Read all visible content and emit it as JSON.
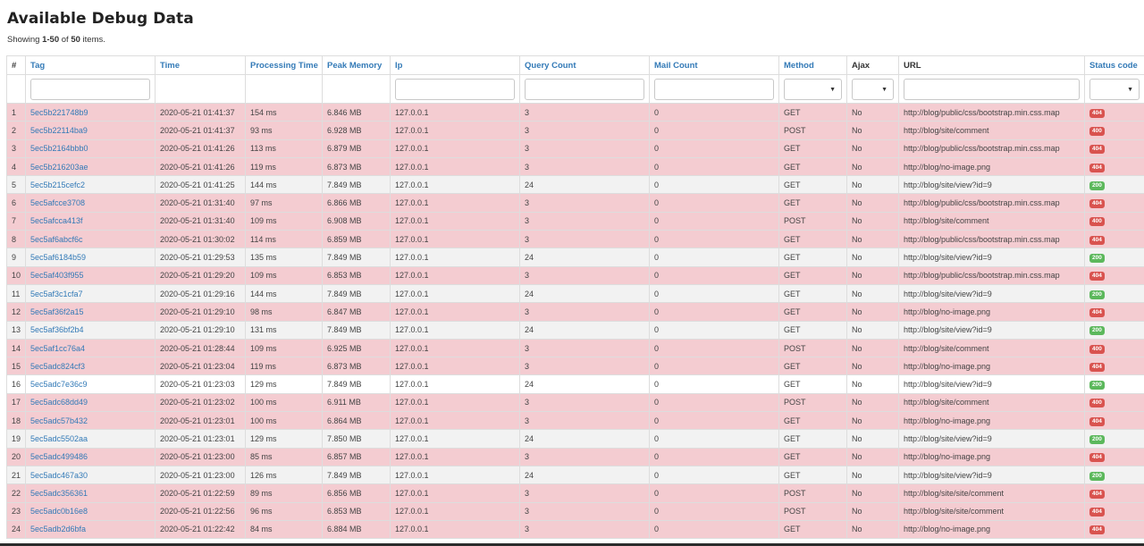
{
  "page": {
    "title": "Available Debug Data",
    "summary_prefix": "Showing ",
    "summary_range": "1-50",
    "summary_mid": " of ",
    "summary_total": "50",
    "summary_suffix": " items."
  },
  "columns": {
    "num": "#",
    "tag": "Tag",
    "time": "Time",
    "processing_time": "Processing Time",
    "peak_memory": "Peak Memory",
    "ip": "Ip",
    "query_count": "Query Count",
    "mail_count": "Mail Count",
    "method": "Method",
    "ajax": "Ajax",
    "url": "URL",
    "status_code": "Status code"
  },
  "colors": {
    "link": "#337ab7",
    "error_row": "#f4ccd1",
    "badge_error": "#d9534f",
    "badge_success": "#5cb85c"
  },
  "rows": [
    {
      "num": "1",
      "tag": "5ec5b221748b9",
      "time": "2020-05-21 01:41:37",
      "proc": "154 ms",
      "mem": "6.846 MB",
      "ip": "127.0.0.1",
      "queries": "3",
      "mails": "0",
      "method": "GET",
      "ajax": "No",
      "url": "http://blog/public/css/bootstrap.min.css.map",
      "status": "404"
    },
    {
      "num": "2",
      "tag": "5ec5b22114ba9",
      "time": "2020-05-21 01:41:37",
      "proc": "93 ms",
      "mem": "6.928 MB",
      "ip": "127.0.0.1",
      "queries": "3",
      "mails": "0",
      "method": "POST",
      "ajax": "No",
      "url": "http://blog/site/comment",
      "status": "400"
    },
    {
      "num": "3",
      "tag": "5ec5b2164bbb0",
      "time": "2020-05-21 01:41:26",
      "proc": "113 ms",
      "mem": "6.879 MB",
      "ip": "127.0.0.1",
      "queries": "3",
      "mails": "0",
      "method": "GET",
      "ajax": "No",
      "url": "http://blog/public/css/bootstrap.min.css.map",
      "status": "404"
    },
    {
      "num": "4",
      "tag": "5ec5b216203ae",
      "time": "2020-05-21 01:41:26",
      "proc": "119 ms",
      "mem": "6.873 MB",
      "ip": "127.0.0.1",
      "queries": "3",
      "mails": "0",
      "method": "GET",
      "ajax": "No",
      "url": "http://blog/no-image.png",
      "status": "404"
    },
    {
      "num": "5",
      "tag": "5ec5b215cefc2",
      "time": "2020-05-21 01:41:25",
      "proc": "144 ms",
      "mem": "7.849 MB",
      "ip": "127.0.0.1",
      "queries": "24",
      "mails": "0",
      "method": "GET",
      "ajax": "No",
      "url": "http://blog/site/view?id=9",
      "status": "200"
    },
    {
      "num": "6",
      "tag": "5ec5afcce3708",
      "time": "2020-05-21 01:31:40",
      "proc": "97 ms",
      "mem": "6.866 MB",
      "ip": "127.0.0.1",
      "queries": "3",
      "mails": "0",
      "method": "GET",
      "ajax": "No",
      "url": "http://blog/public/css/bootstrap.min.css.map",
      "status": "404"
    },
    {
      "num": "7",
      "tag": "5ec5afcca413f",
      "time": "2020-05-21 01:31:40",
      "proc": "109 ms",
      "mem": "6.908 MB",
      "ip": "127.0.0.1",
      "queries": "3",
      "mails": "0",
      "method": "POST",
      "ajax": "No",
      "url": "http://blog/site/comment",
      "status": "400"
    },
    {
      "num": "8",
      "tag": "5ec5af6abcf6c",
      "time": "2020-05-21 01:30:02",
      "proc": "114 ms",
      "mem": "6.859 MB",
      "ip": "127.0.0.1",
      "queries": "3",
      "mails": "0",
      "method": "GET",
      "ajax": "No",
      "url": "http://blog/public/css/bootstrap.min.css.map",
      "status": "404"
    },
    {
      "num": "9",
      "tag": "5ec5af6184b59",
      "time": "2020-05-21 01:29:53",
      "proc": "135 ms",
      "mem": "7.849 MB",
      "ip": "127.0.0.1",
      "queries": "24",
      "mails": "0",
      "method": "GET",
      "ajax": "No",
      "url": "http://blog/site/view?id=9",
      "status": "200"
    },
    {
      "num": "10",
      "tag": "5ec5af403f955",
      "time": "2020-05-21 01:29:20",
      "proc": "109 ms",
      "mem": "6.853 MB",
      "ip": "127.0.0.1",
      "queries": "3",
      "mails": "0",
      "method": "GET",
      "ajax": "No",
      "url": "http://blog/public/css/bootstrap.min.css.map",
      "status": "404"
    },
    {
      "num": "11",
      "tag": "5ec5af3c1cfa7",
      "time": "2020-05-21 01:29:16",
      "proc": "144 ms",
      "mem": "7.849 MB",
      "ip": "127.0.0.1",
      "queries": "24",
      "mails": "0",
      "method": "GET",
      "ajax": "No",
      "url": "http://blog/site/view?id=9",
      "status": "200"
    },
    {
      "num": "12",
      "tag": "5ec5af36f2a15",
      "time": "2020-05-21 01:29:10",
      "proc": "98 ms",
      "mem": "6.847 MB",
      "ip": "127.0.0.1",
      "queries": "3",
      "mails": "0",
      "method": "GET",
      "ajax": "No",
      "url": "http://blog/no-image.png",
      "status": "404"
    },
    {
      "num": "13",
      "tag": "5ec5af36bf2b4",
      "time": "2020-05-21 01:29:10",
      "proc": "131 ms",
      "mem": "7.849 MB",
      "ip": "127.0.0.1",
      "queries": "24",
      "mails": "0",
      "method": "GET",
      "ajax": "No",
      "url": "http://blog/site/view?id=9",
      "status": "200"
    },
    {
      "num": "14",
      "tag": "5ec5af1cc76a4",
      "time": "2020-05-21 01:28:44",
      "proc": "109 ms",
      "mem": "6.925 MB",
      "ip": "127.0.0.1",
      "queries": "3",
      "mails": "0",
      "method": "POST",
      "ajax": "No",
      "url": "http://blog/site/comment",
      "status": "400"
    },
    {
      "num": "15",
      "tag": "5ec5adc824cf3",
      "time": "2020-05-21 01:23:04",
      "proc": "119 ms",
      "mem": "6.873 MB",
      "ip": "127.0.0.1",
      "queries": "3",
      "mails": "0",
      "method": "GET",
      "ajax": "No",
      "url": "http://blog/no-image.png",
      "status": "404"
    },
    {
      "num": "16",
      "tag": "5ec5adc7e36c9",
      "time": "2020-05-21 01:23:03",
      "proc": "129 ms",
      "mem": "7.849 MB",
      "ip": "127.0.0.1",
      "queries": "24",
      "mails": "0",
      "method": "GET",
      "ajax": "No",
      "url": "http://blog/site/view?id=9",
      "status": "200"
    },
    {
      "num": "17",
      "tag": "5ec5adc68dd49",
      "time": "2020-05-21 01:23:02",
      "proc": "100 ms",
      "mem": "6.911 MB",
      "ip": "127.0.0.1",
      "queries": "3",
      "mails": "0",
      "method": "POST",
      "ajax": "No",
      "url": "http://blog/site/comment",
      "status": "400"
    },
    {
      "num": "18",
      "tag": "5ec5adc57b432",
      "time": "2020-05-21 01:23:01",
      "proc": "100 ms",
      "mem": "6.864 MB",
      "ip": "127.0.0.1",
      "queries": "3",
      "mails": "0",
      "method": "GET",
      "ajax": "No",
      "url": "http://blog/no-image.png",
      "status": "404"
    },
    {
      "num": "19",
      "tag": "5ec5adc5502aa",
      "time": "2020-05-21 01:23:01",
      "proc": "129 ms",
      "mem": "7.850 MB",
      "ip": "127.0.0.1",
      "queries": "24",
      "mails": "0",
      "method": "GET",
      "ajax": "No",
      "url": "http://blog/site/view?id=9",
      "status": "200"
    },
    {
      "num": "20",
      "tag": "5ec5adc499486",
      "time": "2020-05-21 01:23:00",
      "proc": "85 ms",
      "mem": "6.857 MB",
      "ip": "127.0.0.1",
      "queries": "3",
      "mails": "0",
      "method": "GET",
      "ajax": "No",
      "url": "http://blog/no-image.png",
      "status": "404"
    },
    {
      "num": "21",
      "tag": "5ec5adc467a30",
      "time": "2020-05-21 01:23:00",
      "proc": "126 ms",
      "mem": "7.849 MB",
      "ip": "127.0.0.1",
      "queries": "24",
      "mails": "0",
      "method": "GET",
      "ajax": "No",
      "url": "http://blog/site/view?id=9",
      "status": "200"
    },
    {
      "num": "22",
      "tag": "5ec5adc356361",
      "time": "2020-05-21 01:22:59",
      "proc": "89 ms",
      "mem": "6.856 MB",
      "ip": "127.0.0.1",
      "queries": "3",
      "mails": "0",
      "method": "POST",
      "ajax": "No",
      "url": "http://blog/site/site/comment",
      "status": "404"
    },
    {
      "num": "23",
      "tag": "5ec5adc0b16e8",
      "time": "2020-05-21 01:22:56",
      "proc": "96 ms",
      "mem": "6.853 MB",
      "ip": "127.0.0.1",
      "queries": "3",
      "mails": "0",
      "method": "POST",
      "ajax": "No",
      "url": "http://blog/site/site/comment",
      "status": "404"
    },
    {
      "num": "24",
      "tag": "5ec5adb2d6bfa",
      "time": "2020-05-21 01:22:42",
      "proc": "84 ms",
      "mem": "6.884 MB",
      "ip": "127.0.0.1",
      "queries": "3",
      "mails": "0",
      "method": "GET",
      "ajax": "No",
      "url": "http://blog/no-image.png",
      "status": "404"
    }
  ]
}
